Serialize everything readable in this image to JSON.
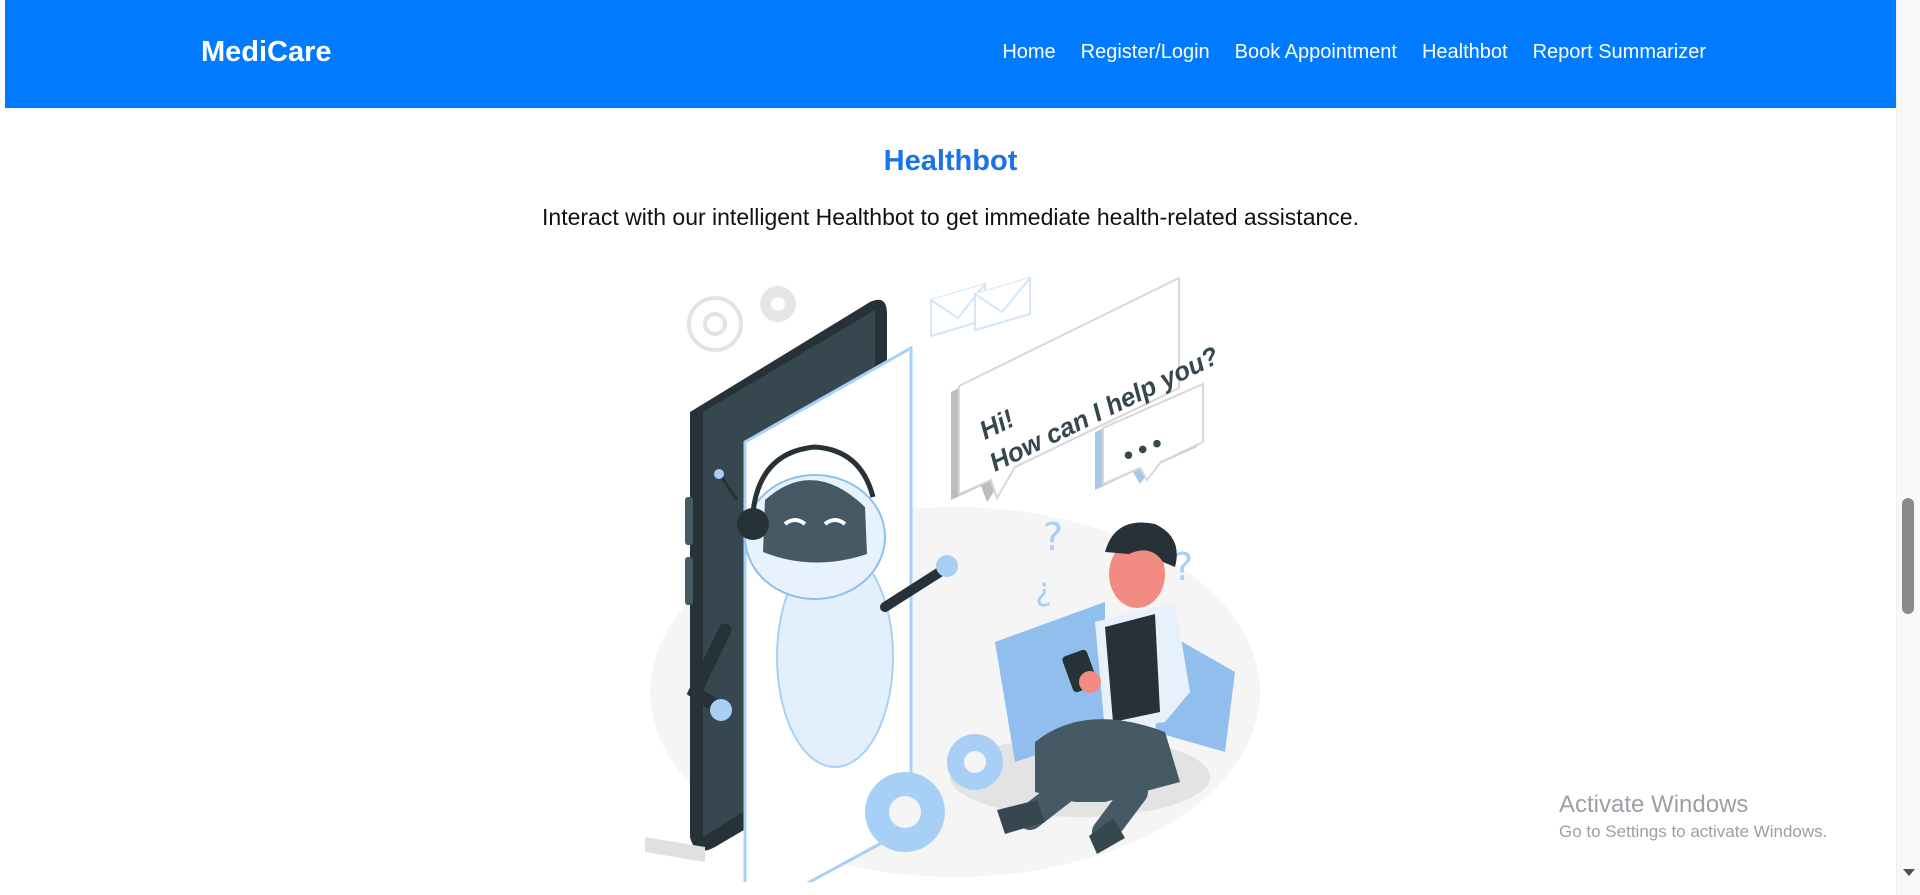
{
  "navbar": {
    "brand": "MediCare",
    "links": [
      "Home",
      "Register/Login",
      "Book Appointment",
      "Healthbot",
      "Report Summarizer"
    ]
  },
  "hero": {
    "title": "Healthbot",
    "description": "Interact with our intelligent Healthbot to get immediate health-related assistance."
  },
  "illustration": {
    "bubble_line1": "Hi!",
    "bubble_line2": "How can I help you?",
    "dots": "•••"
  },
  "watermark": {
    "title": "Activate Windows",
    "subtitle": "Go to Settings to activate Windows."
  },
  "colors": {
    "navbar": "#007bff",
    "title": "#1a73e8",
    "accent_light": "#a8d0f7",
    "dark": "#263238"
  }
}
